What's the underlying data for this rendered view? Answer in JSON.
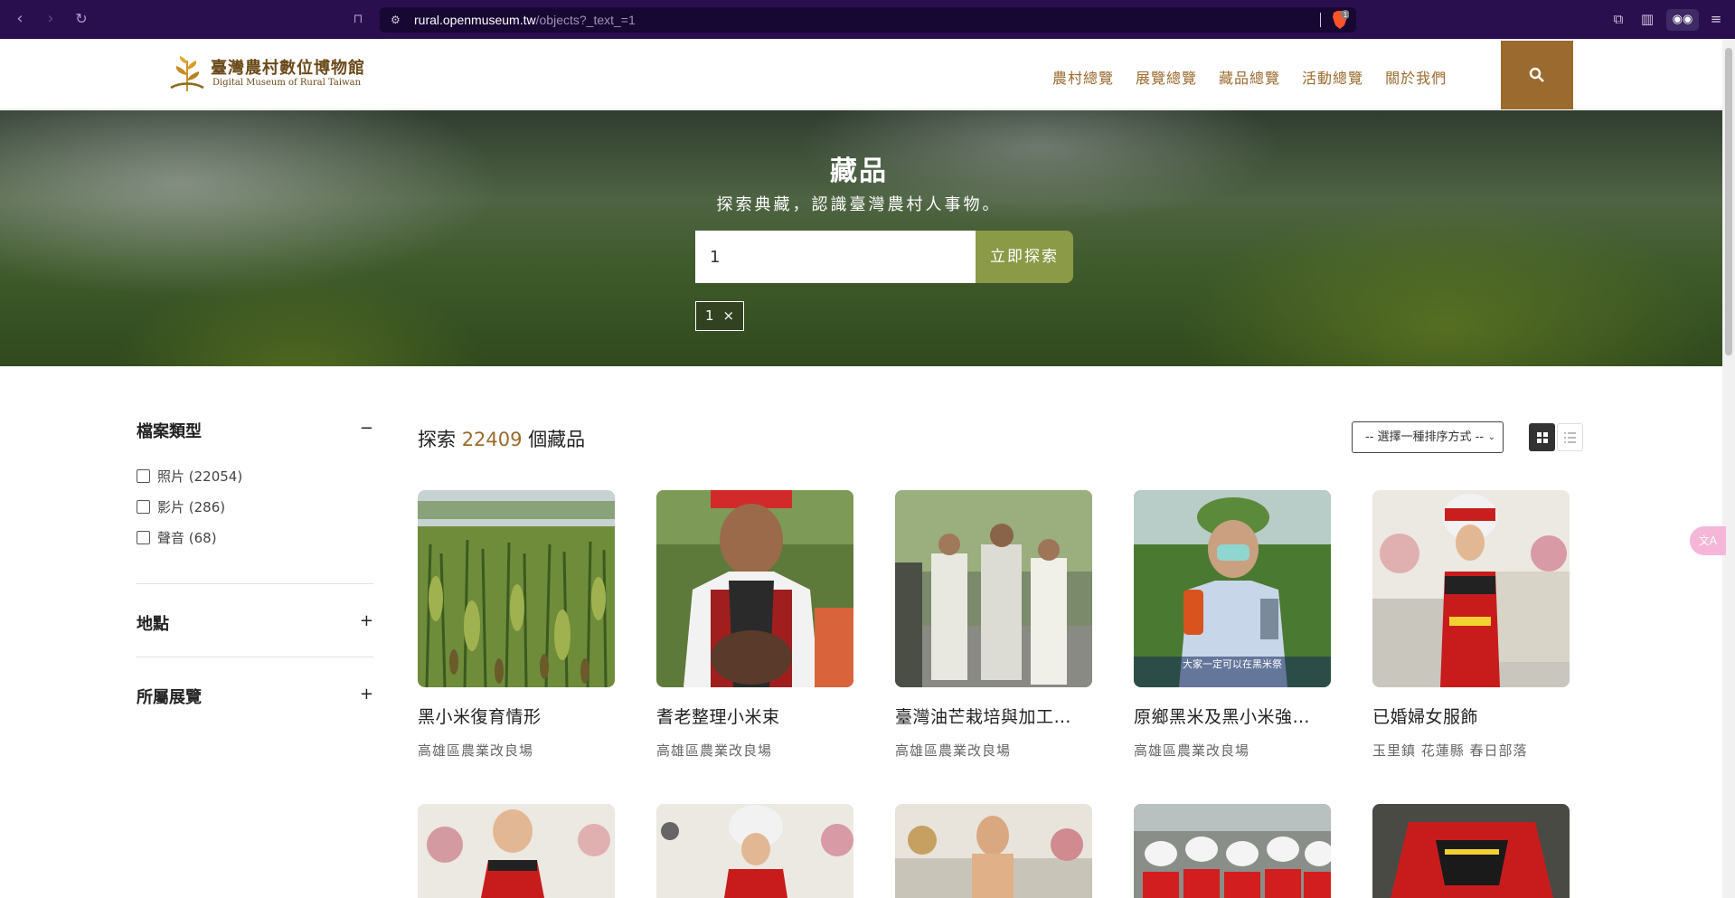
{
  "browser": {
    "url_host": "rural.openmuseum.tw",
    "url_path": "/objects?_text_=1",
    "brave_badge": "1"
  },
  "site": {
    "logo_cn": "臺灣農村數位博物館",
    "logo_en": "Digital Museum of Rural Taiwan",
    "nav": [
      "農村總覽",
      "展覽總覽",
      "藏品總覽",
      "活動總覽",
      "關於我們"
    ]
  },
  "hero": {
    "title": "藏品",
    "subtitle": "探索典藏，認識臺灣農村人事物。",
    "search_value": "1",
    "search_button": "立即探索",
    "active_tag": "1",
    "tag_remove": "×"
  },
  "filters": {
    "file_type": {
      "label": "檔案類型",
      "toggle": "−",
      "options": [
        {
          "label": "照片 (22054)"
        },
        {
          "label": "影片 (286)"
        },
        {
          "label": "聲音 (68)"
        }
      ]
    },
    "location": {
      "label": "地點",
      "toggle": "+"
    },
    "exhibition": {
      "label": "所屬展覽",
      "toggle": "+"
    }
  },
  "results": {
    "prefix": "探索",
    "count": "22409",
    "suffix": "個藏品",
    "sort_placeholder": "-- 選擇一種排序方式 --"
  },
  "items": [
    {
      "title": "黑小米復育情形",
      "subtitle": "高雄區農業改良場"
    },
    {
      "title": "耆老整理小米束",
      "subtitle": "高雄區農業改良場"
    },
    {
      "title": "臺灣油芒栽培與加工…",
      "subtitle": "高雄區農業改良場"
    },
    {
      "title": "原鄉黑米及黑小米強…",
      "subtitle": "高雄區農業改良場",
      "caption": "大家一定可以在黑米祭"
    },
    {
      "title": "已婚婦女服飾",
      "subtitle": "玉里鎮 花蓮縣 春日部落"
    }
  ],
  "colors": {
    "brand_brown": "#9a6a2e",
    "search_green": "#8a9a46",
    "browser_purple": "#2a0f4f"
  }
}
